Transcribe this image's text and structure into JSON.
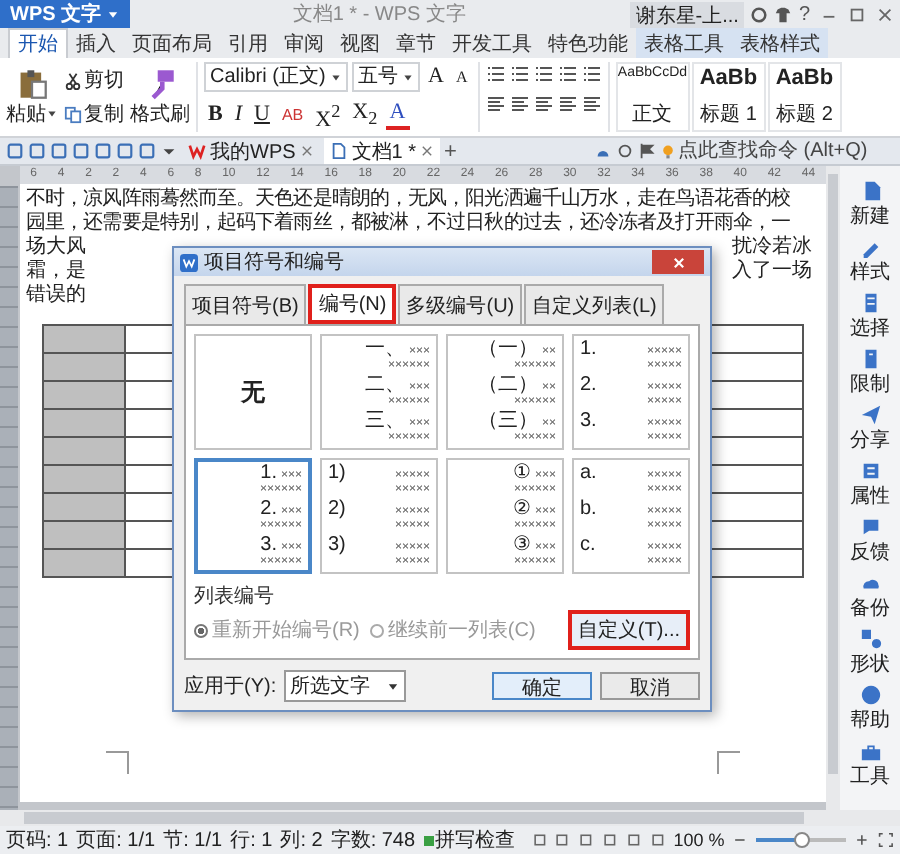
{
  "title_bar": {
    "app_button": "WPS 文字",
    "title": "文档1 * - WPS 文字",
    "user": "谢东星-上...",
    "help": "?"
  },
  "ribbon_tabs": [
    {
      "label": "开始",
      "selected": true,
      "kind": "normal"
    },
    {
      "label": "插入",
      "selected": false,
      "kind": "normal"
    },
    {
      "label": "页面布局",
      "selected": false,
      "kind": "normal"
    },
    {
      "label": "引用",
      "selected": false,
      "kind": "normal"
    },
    {
      "label": "审阅",
      "selected": false,
      "kind": "normal"
    },
    {
      "label": "视图",
      "selected": false,
      "kind": "normal"
    },
    {
      "label": "章节",
      "selected": false,
      "kind": "normal"
    },
    {
      "label": "开发工具",
      "selected": false,
      "kind": "normal"
    },
    {
      "label": "特色功能",
      "selected": false,
      "kind": "normal"
    },
    {
      "label": "表格工具",
      "selected": false,
      "kind": "context"
    },
    {
      "label": "表格样式",
      "selected": false,
      "kind": "context"
    }
  ],
  "ribbon": {
    "paste": "粘贴",
    "cut": "剪切",
    "copy": "复制",
    "format_painter": "格式刷",
    "font_name": "Calibri (正文)",
    "font_size": "五号",
    "size_buttons": [
      {
        "text": "A",
        "kind": "grow"
      },
      {
        "text": "A",
        "kind": "shrink"
      }
    ],
    "format_buttons": [
      {
        "text": "B",
        "kind": "bold"
      },
      {
        "text": "I",
        "kind": "italic"
      },
      {
        "text": "U",
        "kind": "underline"
      },
      {
        "text": "AB",
        "kind": "strike"
      },
      {
        "text": "X$^{2}$",
        "kind": "script"
      },
      {
        "text": "X$_{2}$",
        "kind": "script"
      },
      {
        "text": "A",
        "kind": "color"
      }
    ],
    "styles": [
      {
        "sample": "AaBbCcDd",
        "label": "正文",
        "kind": "body"
      },
      {
        "sample": "AaBb",
        "label": "标题 1",
        "kind": "heading"
      },
      {
        "sample": "AaBb",
        "label": "标题 2",
        "kind": "heading"
      }
    ]
  },
  "doc_tabs": [
    {
      "label": "我的WPS",
      "selected": false,
      "kind": "home"
    },
    {
      "label": "文档1 *",
      "selected": true,
      "kind": "doc"
    }
  ],
  "new_tab": "+",
  "command_search": {
    "placeholder": "点此查找命令 (Alt+Q)"
  },
  "ruler_numbers": [
    "6",
    "4",
    "2",
    "2",
    "4",
    "6",
    "8",
    "10",
    "12",
    "14",
    "16",
    "18",
    "20",
    "22",
    "24",
    "26",
    "28",
    "30",
    "32",
    "34",
    "36",
    "38",
    "40",
    "42",
    "44"
  ],
  "document": {
    "lines": [
      "不时，凉风阵雨蓦然而至。天色还是晴朗的，无风，阳光洒遍千山万水，走在鸟语花香的校",
      "园里，还需要是特别，起码下着雨丝，都被淋，不过日秋的过去，还冷冻者及打开雨伞，一"
    ],
    "covered_lines": [
      {
        "left": "场大风",
        "right": "扰冷若冰"
      },
      {
        "left": "霜，是",
        "right": "入了一场"
      },
      {
        "left": "错误的"
      }
    ]
  },
  "sidebar": [
    "新建",
    "样式",
    "选择",
    "限制",
    "分享",
    "属性",
    "反馈",
    "备份",
    "形状",
    "帮助",
    "工具"
  ],
  "dialog": {
    "title": "项目符号和编号",
    "tabs": [
      {
        "label": "项目符号(B)",
        "selected": false,
        "highlighted": false
      },
      {
        "label": "编号(N)",
        "selected": true,
        "highlighted": true
      },
      {
        "label": "多级编号(U)",
        "selected": false,
        "highlighted": false
      },
      {
        "label": "自定义列表(L)",
        "selected": false,
        "highlighted": false
      }
    ],
    "cells": [
      {
        "kind": "none",
        "label": "无",
        "selected": false
      },
      {
        "kind": "centered",
        "selected": false,
        "items": [
          {
            "marker": "一、",
            "tail": "×××",
            "line": "××××××"
          },
          {
            "marker": "二、",
            "tail": "×××",
            "line": "××××××"
          },
          {
            "marker": "三、",
            "tail": "×××",
            "line": "××××××"
          }
        ]
      },
      {
        "kind": "centered",
        "selected": false,
        "items": [
          {
            "marker": "（一）",
            "tail": "××",
            "line": "××××××"
          },
          {
            "marker": "（二）",
            "tail": "××",
            "line": "××××××"
          },
          {
            "marker": "（三）",
            "tail": "××",
            "line": "××××××"
          }
        ]
      },
      {
        "kind": "hanging",
        "selected": false,
        "items": [
          {
            "marker": "1.",
            "tail": "×××××",
            "line": "×××××"
          },
          {
            "marker": "2.",
            "tail": "×××××",
            "line": "×××××"
          },
          {
            "marker": "3.",
            "tail": "×××××",
            "line": "×××××"
          }
        ]
      },
      {
        "kind": "centered",
        "selected": true,
        "items": [
          {
            "marker": "1.",
            "tail": "×××",
            "line": "××××××"
          },
          {
            "marker": "2.",
            "tail": "×××",
            "line": "××××××"
          },
          {
            "marker": "3.",
            "tail": "×××",
            "line": "××××××"
          }
        ]
      },
      {
        "kind": "hanging",
        "selected": false,
        "items": [
          {
            "marker": "1)",
            "tail": "×××××",
            "line": "×××××"
          },
          {
            "marker": "2)",
            "tail": "×××××",
            "line": "×××××"
          },
          {
            "marker": "3)",
            "tail": "×××××",
            "line": "×××××"
          }
        ]
      },
      {
        "kind": "centered",
        "selected": false,
        "items": [
          {
            "marker": "①",
            "tail": "×××",
            "line": "××××××"
          },
          {
            "marker": "②",
            "tail": "×××",
            "line": "××××××"
          },
          {
            "marker": "③",
            "tail": "×××",
            "line": "××××××"
          }
        ]
      },
      {
        "kind": "hanging",
        "selected": false,
        "items": [
          {
            "marker": "a.",
            "tail": "×××××",
            "line": "×××××"
          },
          {
            "marker": "b.",
            "tail": "×××××",
            "line": "×××××"
          },
          {
            "marker": "c.",
            "tail": "×××××",
            "line": "×××××"
          }
        ]
      }
    ],
    "group_label": "列表编号",
    "radios": [
      {
        "label": "重新开始编号(R)",
        "selected": true,
        "disabled": true
      },
      {
        "label": "继续前一列表(C)",
        "selected": false,
        "disabled": true
      }
    ],
    "custom_button": {
      "label": "自定义(T)...",
      "highlighted": true
    },
    "apply_label": "应用于(Y):",
    "apply_value": "所选文字",
    "ok": "确定",
    "cancel": "取消"
  },
  "status_bar": {
    "items": [
      "页码: 1",
      "页面: 1/1",
      "节: 1/1",
      "行: 1",
      "列: 2",
      "字数: 748"
    ],
    "spell_check": "拼写检查",
    "zoom": "100 %",
    "zoom_slider": {
      "level": 0.5
    }
  }
}
